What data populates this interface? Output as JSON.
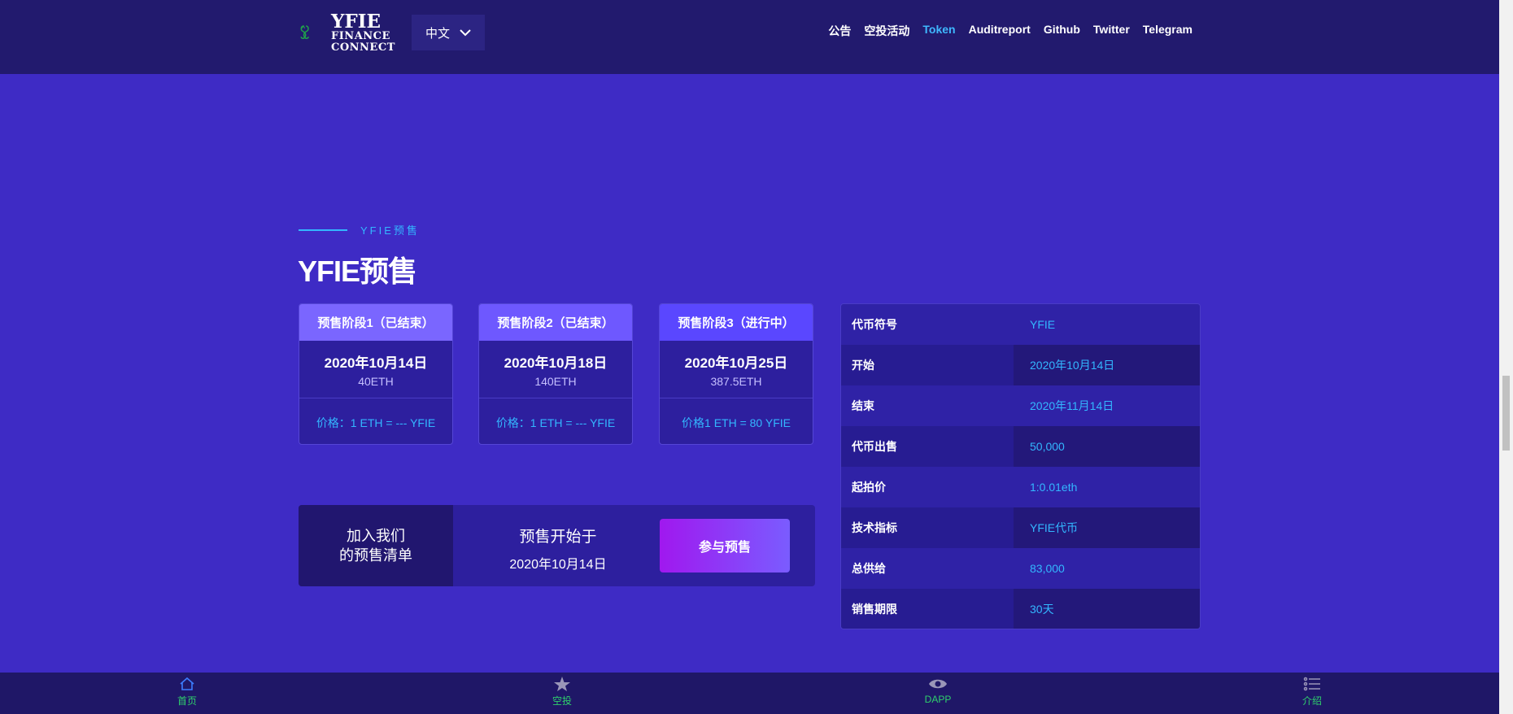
{
  "header": {
    "logo": {
      "line1": "YFIE",
      "line2": "FINANCE",
      "line3": "CONNECT"
    },
    "lang": {
      "label": "中文"
    },
    "nav": [
      {
        "label": "公告"
      },
      {
        "label": "空投活动"
      },
      {
        "label": "Token",
        "active": true
      },
      {
        "label": "Auditreport"
      },
      {
        "label": "Github"
      },
      {
        "label": "Twitter"
      },
      {
        "label": "Telegram"
      }
    ]
  },
  "section": {
    "eyebrow": "YFIE预售",
    "title": "YFIE预售"
  },
  "stages": [
    {
      "title": "预售阶段1（已结束）",
      "date": "2020年10月14日",
      "amount": "40ETH",
      "price": "价格：1 ETH = --- YFIE",
      "color": "#7a66ff"
    },
    {
      "title": "预售阶段2（已结束）",
      "date": "2020年10月18日",
      "amount": "140ETH",
      "price": "价格：1 ETH = --- YFIE",
      "color": "#6e58ff"
    },
    {
      "title": "预售阶段3（进行中）",
      "date": "2020年10月25日",
      "amount": "387.5ETH",
      "price": "价格1 ETH = 80 YFIE",
      "color": "#5a47ff"
    }
  ],
  "join": {
    "left_line1": "加入我们",
    "left_line2": "的预售清单",
    "start_label": "预售开始于",
    "start_date": "2020年10月14日",
    "button": "参与预售"
  },
  "info": [
    {
      "k": "代币符号",
      "v": "YFIE"
    },
    {
      "k": "开始",
      "v": "2020年10月14日"
    },
    {
      "k": "结束",
      "v": "2020年11月14日"
    },
    {
      "k": "代币出售",
      "v": "50,000"
    },
    {
      "k": "起拍价",
      "v": "1:0.01eth"
    },
    {
      "k": "技术指标",
      "v": "YFIE代币"
    },
    {
      "k": "总供给",
      "v": "83,000"
    },
    {
      "k": "销售期限",
      "v": "30天"
    }
  ],
  "footer": [
    {
      "label": "首页",
      "icon": "home-icon"
    },
    {
      "label": "空投",
      "icon": "airdrop-icon"
    },
    {
      "label": "DAPP",
      "icon": "eye-icon"
    },
    {
      "label": "介绍",
      "icon": "list-icon"
    }
  ],
  "colors": {
    "bg": "#3e2bc5",
    "header": "#221a6e",
    "accent": "#33b7ff",
    "footer_text": "#2fd06c"
  }
}
